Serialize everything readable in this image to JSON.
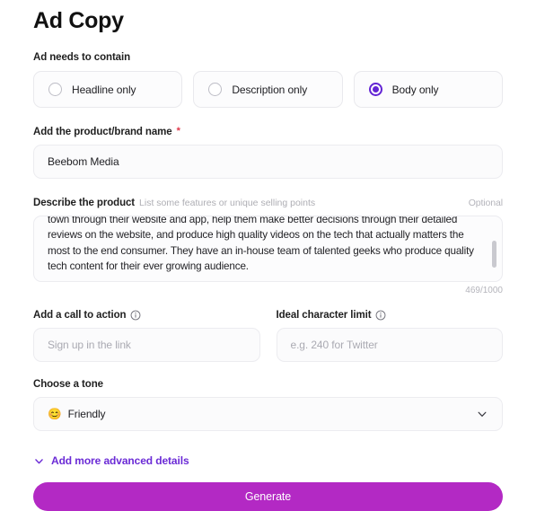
{
  "page": {
    "title": "Ad Copy"
  },
  "contains": {
    "label": "Ad needs to contain",
    "options": [
      {
        "label": "Headline only",
        "selected": false
      },
      {
        "label": "Description only",
        "selected": false
      },
      {
        "label": "Body only",
        "selected": true
      }
    ]
  },
  "brand": {
    "label": "Add the product/brand name",
    "required_mark": "*",
    "value": "Beebom Media",
    "placeholder": ""
  },
  "describe": {
    "label": "Describe the product",
    "hint": "List some features or unique selling points",
    "optional": "Optional",
    "value": "Beebom Media is a tech media company. They serve people with the hottest tech news in the town through their website and app, help them make better decisions through their detailed reviews on the website, and produce high quality videos on the tech that actually matters the most to the end consumer. They have an in-house team of talented geeks who produce quality tech content for their ever growing audience.",
    "char_count": "469/1000"
  },
  "cta": {
    "label": "Add a call to action",
    "info_icon": "info-icon",
    "value": "",
    "placeholder": "Sign up in the link"
  },
  "char_limit": {
    "label": "Ideal character limit",
    "info_icon": "info-icon",
    "value": "",
    "placeholder": "e.g. 240 for Twitter"
  },
  "tone": {
    "label": "Choose a tone",
    "emoji": "😊",
    "value": "Friendly",
    "chevron_icon": "chevron-down-icon"
  },
  "advanced": {
    "label": "Add more advanced details",
    "chevron_icon": "chevron-down-icon"
  },
  "submit": {
    "label": "Generate"
  },
  "colors": {
    "accent_purple": "#6325d4",
    "brand_magenta": "#b329c4",
    "required_red": "#e0384a"
  }
}
